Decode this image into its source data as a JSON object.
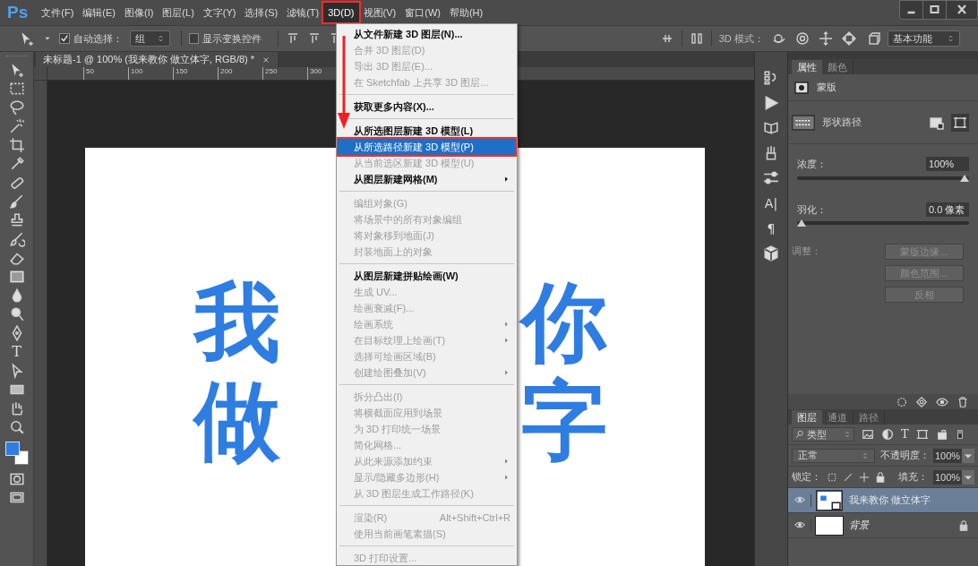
{
  "menubar": {
    "logo": "Ps",
    "menus": [
      {
        "label": "文件(F)",
        "selected": false,
        "annotated": false
      },
      {
        "label": "编辑(E)",
        "selected": false,
        "annotated": false
      },
      {
        "label": "图像(I)",
        "selected": false,
        "annotated": false
      },
      {
        "label": "图层(L)",
        "selected": false,
        "annotated": false
      },
      {
        "label": "文字(Y)",
        "selected": false,
        "annotated": false
      },
      {
        "label": "选择(S)",
        "selected": false,
        "annotated": false
      },
      {
        "label": "滤镜(T)",
        "selected": false,
        "annotated": false
      },
      {
        "label": "3D(D)",
        "selected": true,
        "annotated": true
      },
      {
        "label": "视图(V)",
        "selected": false,
        "annotated": false
      },
      {
        "label": "窗口(W)",
        "selected": false,
        "annotated": false
      },
      {
        "label": "帮助(H)",
        "selected": false,
        "annotated": false
      }
    ]
  },
  "options_bar": {
    "auto_select": {
      "label": "自动选择：",
      "checked": true
    },
    "auto_select_target": "组",
    "transform_controls": {
      "label": "显示变换控件",
      "checked": false
    },
    "mode_label": "3D 模式：",
    "workspace": "基本功能"
  },
  "tools": [
    {
      "kind": "move"
    },
    {
      "kind": "marquee"
    },
    {
      "kind": "lasso"
    },
    {
      "kind": "wand"
    },
    {
      "kind": "crop"
    },
    {
      "kind": "eyedropper"
    },
    {
      "kind": "healing"
    },
    {
      "kind": "brush"
    },
    {
      "kind": "stamp"
    },
    {
      "kind": "history"
    },
    {
      "kind": "eraser"
    },
    {
      "kind": "gradient"
    },
    {
      "kind": "drop"
    },
    {
      "kind": "dodge"
    },
    {
      "kind": "pen"
    },
    {
      "kind": "text",
      "glyph": "T"
    },
    {
      "kind": "select"
    },
    {
      "kind": "shape"
    },
    {
      "kind": "hand"
    },
    {
      "kind": "zoom"
    },
    {
      "kind": "colors"
    },
    {
      "kind": "mask"
    },
    {
      "kind": "screen"
    }
  ],
  "document_tab": {
    "title": "未标题-1 @ 100% (我来教你 做立体字, RGB/8) *"
  },
  "ruler_labels": [
    "50",
    "100",
    "150",
    "200",
    "250",
    "300"
  ],
  "canvas_text": [
    {
      "left": "我",
      "right": "你"
    },
    {
      "left": "做",
      "right": "字"
    }
  ],
  "menu": {
    "items": [
      {
        "kind": "item",
        "label": "从文件新建 3D 图层(N)...",
        "disabled": false,
        "selected": false
      },
      {
        "kind": "item",
        "label": "合并 3D 图层(D)",
        "disabled": true,
        "selected": false
      },
      {
        "kind": "item",
        "label": "导出 3D 图层(E)...",
        "disabled": true,
        "selected": false
      },
      {
        "kind": "item",
        "label": "在 Sketchfab 上共享 3D 图层...",
        "disabled": true,
        "selected": false
      },
      {
        "kind": "separator"
      },
      {
        "kind": "item",
        "label": "获取更多内容(X)...",
        "disabled": false,
        "selected": false
      },
      {
        "kind": "separator"
      },
      {
        "kind": "item",
        "label": "从所选图层新建 3D 模型(L)",
        "disabled": false,
        "selected": false
      },
      {
        "kind": "item",
        "label": "从所选路径新建 3D 模型(P)",
        "disabled": false,
        "selected": true,
        "annotated": true
      },
      {
        "kind": "item",
        "label": "从当前选区新建 3D 模型(U)",
        "disabled": true,
        "selected": false
      },
      {
        "kind": "item",
        "label": "从图层新建网格(M)",
        "disabled": false,
        "selected": false,
        "submenu": true
      },
      {
        "kind": "separator"
      },
      {
        "kind": "item",
        "label": "编组对象(G)",
        "disabled": true,
        "selected": false
      },
      {
        "kind": "item",
        "label": "将场景中的所有对象编组",
        "disabled": true,
        "selected": false
      },
      {
        "kind": "item",
        "label": "将对象移到地面(J)",
        "disabled": true,
        "selected": false
      },
      {
        "kind": "item",
        "label": "封装地面上的对象",
        "disabled": true,
        "selected": false
      },
      {
        "kind": "separator"
      },
      {
        "kind": "item",
        "label": "从图层新建拼贴绘画(W)",
        "disabled": false,
        "selected": false
      },
      {
        "kind": "item",
        "label": "生成 UV...",
        "disabled": true,
        "selected": false
      },
      {
        "kind": "item",
        "label": "绘画衰减(F)...",
        "disabled": true,
        "selected": false
      },
      {
        "kind": "item",
        "label": "绘画系统",
        "disabled": true,
        "selected": false,
        "submenu": true
      },
      {
        "kind": "item",
        "label": "在目标纹理上绘画(T)",
        "disabled": true,
        "selected": false,
        "submenu": true
      },
      {
        "kind": "item",
        "label": "选择可绘画区域(B)",
        "disabled": true,
        "selected": false
      },
      {
        "kind": "item",
        "label": "创建绘图叠加(V)",
        "disabled": true,
        "selected": false,
        "submenu": true
      },
      {
        "kind": "separator"
      },
      {
        "kind": "item",
        "label": "拆分凸出(I)",
        "disabled": true,
        "selected": false
      },
      {
        "kind": "item",
        "label": "将横截面应用到场景",
        "disabled": true,
        "selected": false
      },
      {
        "kind": "item",
        "label": "为 3D 打印统一场景",
        "disabled": true,
        "selected": false
      },
      {
        "kind": "item",
        "label": "简化网格...",
        "disabled": true,
        "selected": false
      },
      {
        "kind": "item",
        "label": "从此来源添加约束",
        "disabled": true,
        "selected": false,
        "submenu": true
      },
      {
        "kind": "item",
        "label": "显示/隐藏多边形(H)",
        "disabled": true,
        "selected": false,
        "submenu": true
      },
      {
        "kind": "item",
        "label": "从 3D 图层生成工作路径(K)",
        "disabled": true,
        "selected": false
      },
      {
        "kind": "separator"
      },
      {
        "kind": "item",
        "label": "渲染(R)",
        "shortcut": "Alt+Shift+Ctrl+R",
        "disabled": true,
        "selected": false
      },
      {
        "kind": "item",
        "label": "使用当前画笔素描(S)",
        "disabled": true,
        "selected": false
      },
      {
        "kind": "separator"
      },
      {
        "kind": "item",
        "label": "3D 打印设置...",
        "disabled": true,
        "selected": false
      }
    ]
  },
  "dock": [
    {
      "kind": "history"
    },
    {
      "kind": "play"
    },
    {
      "kind": "clone"
    },
    {
      "kind": "brushes"
    },
    {
      "kind": "sliders"
    },
    {
      "kind": "character",
      "glyph": "A|"
    },
    {
      "kind": "paragraph",
      "glyph": "¶"
    },
    {
      "kind": "cube"
    }
  ],
  "properties_panel": {
    "tabs": [
      {
        "label": "属性",
        "selected": true
      },
      {
        "label": "颜色",
        "selected": false
      }
    ],
    "mask_label": "蒙版",
    "path_label": "形状路径",
    "density": {
      "label": "浓度：",
      "value": "100%",
      "level": 1
    },
    "feather": {
      "label": "羽化：",
      "value": "0.0 像素",
      "level": 0
    },
    "adjust_label": "调整：",
    "buttons": [
      {
        "label": "蒙版边缘...",
        "disabled": true
      },
      {
        "label": "颜色范围...",
        "disabled": true
      },
      {
        "label": "反相",
        "disabled": true
      }
    ]
  },
  "layers_panel": {
    "tabs": [
      {
        "label": "图层",
        "selected": true
      },
      {
        "label": "通道",
        "selected": false
      },
      {
        "label": "路径",
        "selected": false
      }
    ],
    "filter": "类型",
    "type_filter_glyph": "T",
    "blend_mode": "正常",
    "opacity_label": "不透明度：",
    "opacity": "100%",
    "lock_label": "锁定：",
    "fill_label": "填充：",
    "fill": "100%",
    "layers": [
      {
        "name": "我来教你 做立体字",
        "kind": "shape",
        "selected": true,
        "visible": true,
        "locked": false
      },
      {
        "name": "背景",
        "kind": "background",
        "selected": false,
        "visible": true,
        "locked": true
      }
    ]
  }
}
